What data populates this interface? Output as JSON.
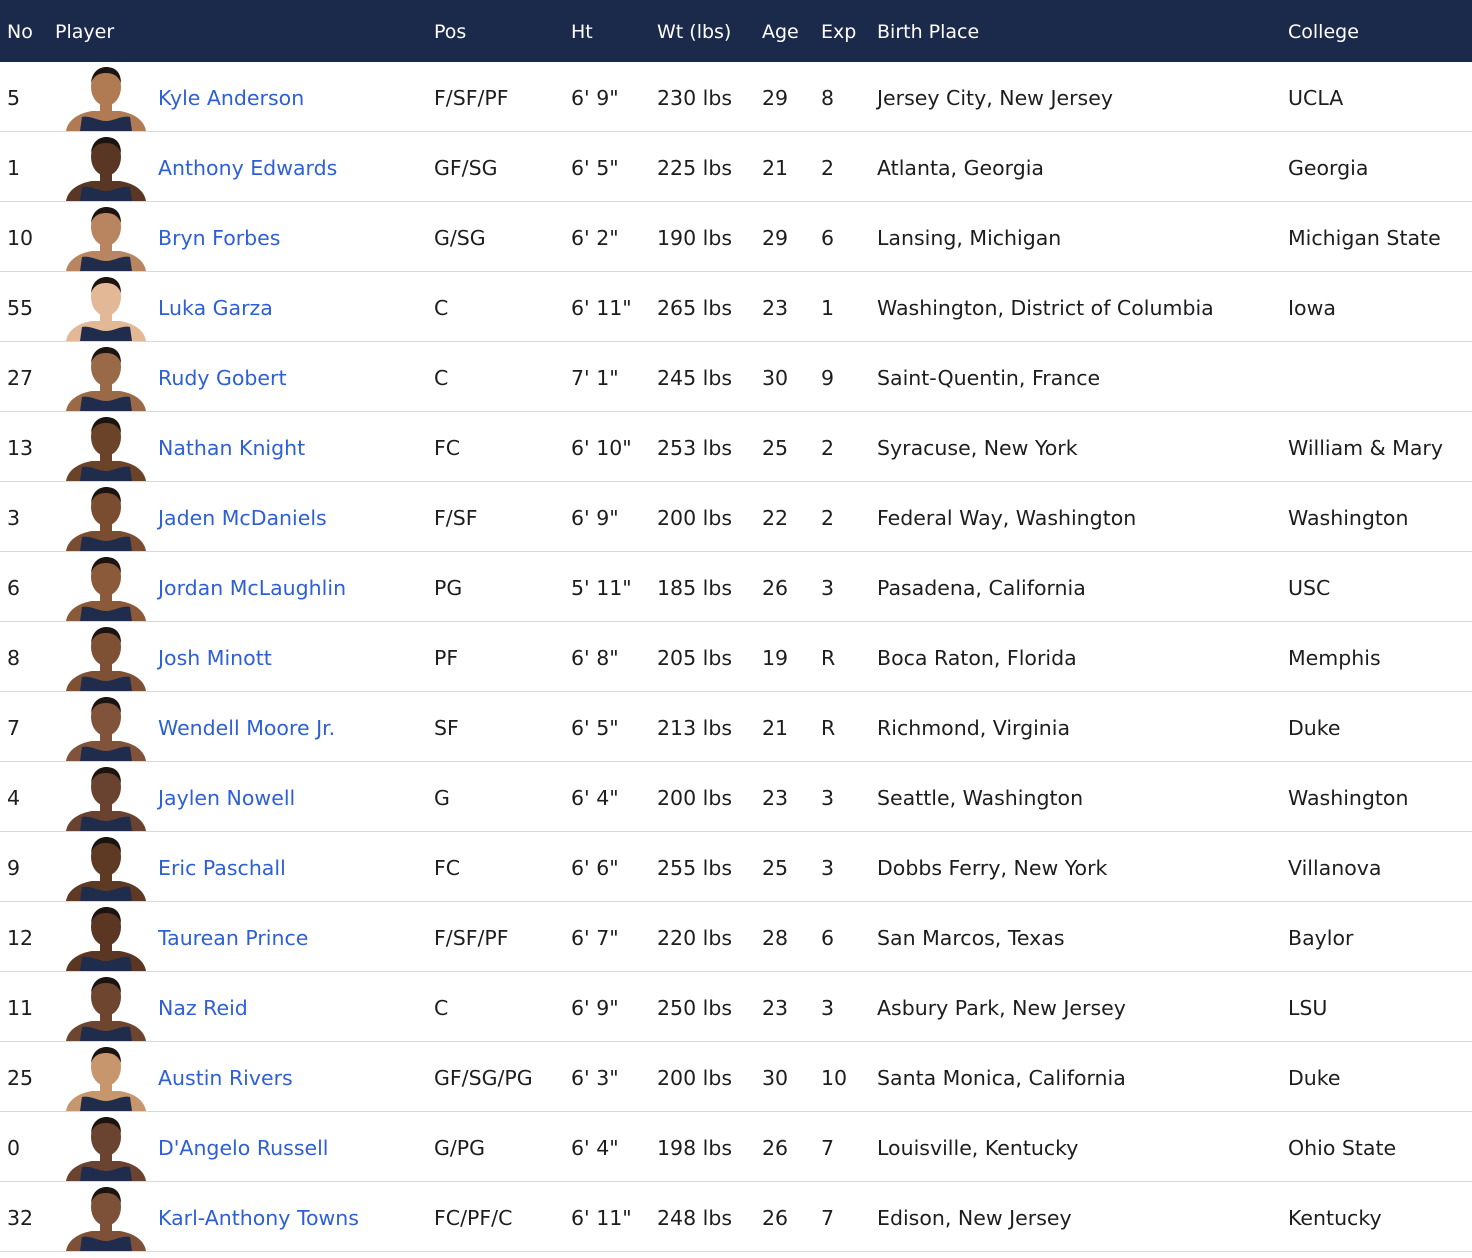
{
  "columns": {
    "no": "No",
    "player": "Player",
    "pos": "Pos",
    "ht": "Ht",
    "wt": "Wt (lbs)",
    "age": "Age",
    "exp": "Exp",
    "birth_place": "Birth Place",
    "college": "College"
  },
  "colors": {
    "header_bg": "#1b2a4a",
    "link": "#2d5fd6",
    "jersey": "#1f2c4c"
  },
  "rows": [
    {
      "no": "5",
      "name": "Kyle Anderson",
      "pos": "F/SF/PF",
      "ht": "6' 9\"",
      "wt": "230 lbs",
      "age": "29",
      "exp": "8",
      "birth_place": "Jersey City, New Jersey",
      "college": "UCLA",
      "skin": "#b07a52"
    },
    {
      "no": "1",
      "name": "Anthony Edwards",
      "pos": "GF/SG",
      "ht": "6' 5\"",
      "wt": "225 lbs",
      "age": "21",
      "exp": "2",
      "birth_place": "Atlanta, Georgia",
      "college": "Georgia",
      "skin": "#5a3724"
    },
    {
      "no": "10",
      "name": "Bryn Forbes",
      "pos": "G/SG",
      "ht": "6' 2\"",
      "wt": "190 lbs",
      "age": "29",
      "exp": "6",
      "birth_place": "Lansing, Michigan",
      "college": "Michigan State",
      "skin": "#b98560"
    },
    {
      "no": "55",
      "name": "Luka Garza",
      "pos": "C",
      "ht": "6' 11\"",
      "wt": "265 lbs",
      "age": "23",
      "exp": "1",
      "birth_place": "Washington, District of Columbia",
      "college": "Iowa",
      "skin": "#e2b896"
    },
    {
      "no": "27",
      "name": "Rudy Gobert",
      "pos": "C",
      "ht": "7' 1\"",
      "wt": "245 lbs",
      "age": "30",
      "exp": "9",
      "birth_place": "Saint-Quentin, France",
      "college": "",
      "skin": "#9a6a48"
    },
    {
      "no": "13",
      "name": "Nathan Knight",
      "pos": "FC",
      "ht": "6' 10\"",
      "wt": "253 lbs",
      "age": "25",
      "exp": "2",
      "birth_place": "Syracuse, New York",
      "college": "William & Mary",
      "skin": "#6b4329"
    },
    {
      "no": "3",
      "name": "Jaden McDaniels",
      "pos": "F/SF",
      "ht": "6' 9\"",
      "wt": "200 lbs",
      "age": "22",
      "exp": "2",
      "birth_place": "Federal Way, Washington",
      "college": "Washington",
      "skin": "#7a4c30"
    },
    {
      "no": "6",
      "name": "Jordan McLaughlin",
      "pos": "PG",
      "ht": "5' 11\"",
      "wt": "185 lbs",
      "age": "26",
      "exp": "3",
      "birth_place": "Pasadena, California",
      "college": "USC",
      "skin": "#8a5a3a"
    },
    {
      "no": "8",
      "name": "Josh Minott",
      "pos": "PF",
      "ht": "6' 8\"",
      "wt": "205 lbs",
      "age": "19",
      "exp": "R",
      "birth_place": "Boca Raton, Florida",
      "college": "Memphis",
      "skin": "#7e5034"
    },
    {
      "no": "7",
      "name": "Wendell Moore Jr.",
      "pos": "SF",
      "ht": "6' 5\"",
      "wt": "213 lbs",
      "age": "21",
      "exp": "R",
      "birth_place": "Richmond, Virginia",
      "college": "Duke",
      "skin": "#80533a"
    },
    {
      "no": "4",
      "name": "Jaylen Nowell",
      "pos": "G",
      "ht": "6' 4\"",
      "wt": "200 lbs",
      "age": "23",
      "exp": "3",
      "birth_place": "Seattle, Washington",
      "college": "Washington",
      "skin": "#6a4330"
    },
    {
      "no": "9",
      "name": "Eric Paschall",
      "pos": "FC",
      "ht": "6' 6\"",
      "wt": "255 lbs",
      "age": "25",
      "exp": "3",
      "birth_place": "Dobbs Ferry, New York",
      "college": "Villanova",
      "skin": "#5e3a24"
    },
    {
      "no": "12",
      "name": "Taurean Prince",
      "pos": "F/SF/PF",
      "ht": "6' 7\"",
      "wt": "220 lbs",
      "age": "28",
      "exp": "6",
      "birth_place": "San Marcos, Texas",
      "college": "Baylor",
      "skin": "#5a3623"
    },
    {
      "no": "11",
      "name": "Naz Reid",
      "pos": "C",
      "ht": "6' 9\"",
      "wt": "250 lbs",
      "age": "23",
      "exp": "3",
      "birth_place": "Asbury Park, New Jersey",
      "college": "LSU",
      "skin": "#6e4630"
    },
    {
      "no": "25",
      "name": "Austin Rivers",
      "pos": "GF/SG/PG",
      "ht": "6' 3\"",
      "wt": "200 lbs",
      "age": "30",
      "exp": "10",
      "birth_place": "Santa Monica, California",
      "college": "Duke",
      "skin": "#c8966c"
    },
    {
      "no": "0",
      "name": "D'Angelo Russell",
      "pos": "G/PG",
      "ht": "6' 4\"",
      "wt": "198 lbs",
      "age": "26",
      "exp": "7",
      "birth_place": "Louisville, Kentucky",
      "college": "Ohio State",
      "skin": "#6a4430"
    },
    {
      "no": "32",
      "name": "Karl-Anthony Towns",
      "pos": "FC/PF/C",
      "ht": "6' 11\"",
      "wt": "248 lbs",
      "age": "26",
      "exp": "7",
      "birth_place": "Edison, New Jersey",
      "college": "Kentucky",
      "skin": "#7c5138"
    }
  ]
}
